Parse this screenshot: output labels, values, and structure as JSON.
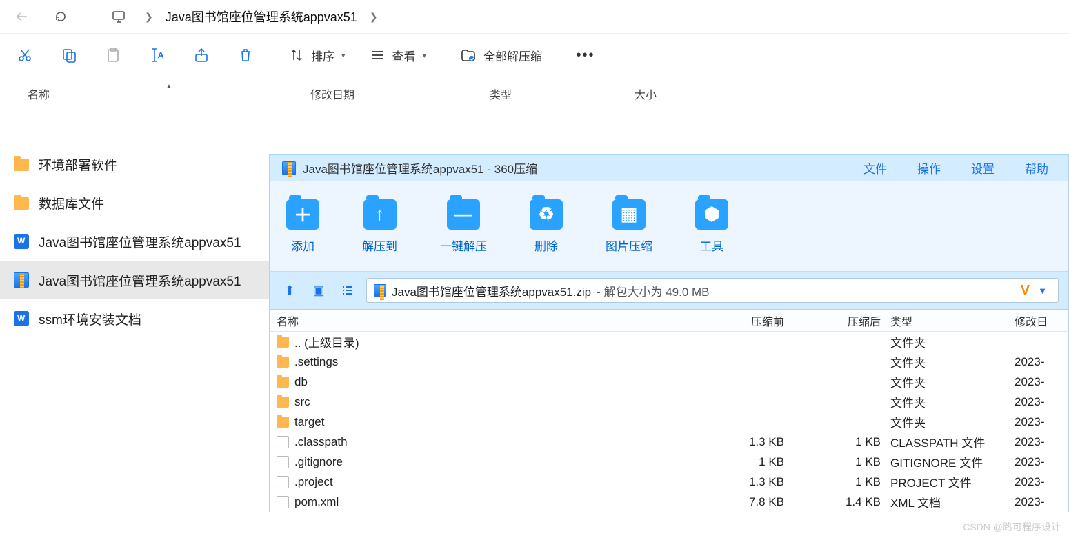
{
  "breadcrumb": {
    "title": "Java图书馆座位管理系统appvax51"
  },
  "toolbar": {
    "sort": "排序",
    "view": "查看",
    "extract_all": "全部解压缩"
  },
  "columns": {
    "name": "名称",
    "date": "修改日期",
    "type": "类型",
    "size": "大小"
  },
  "left_items": [
    {
      "icon": "folder",
      "label": "环境部署软件"
    },
    {
      "icon": "folder",
      "label": "数据库文件"
    },
    {
      "icon": "doc",
      "label": "Java图书馆座位管理系统appvax51"
    },
    {
      "icon": "zip",
      "label": "Java图书馆座位管理系统appvax51",
      "selected": true
    },
    {
      "icon": "doc",
      "label": "ssm环境安装文档"
    }
  ],
  "archive": {
    "title_prefix": "Java图书馆座位管理系统appvax51",
    "title_app": "360压缩",
    "menus": [
      "文件",
      "操作",
      "设置",
      "帮助"
    ],
    "tools": [
      {
        "label": "添加",
        "glyph": "＋"
      },
      {
        "label": "解压到",
        "glyph": "↑"
      },
      {
        "label": "一键解压",
        "glyph": "—"
      },
      {
        "label": "删除",
        "glyph": "♻"
      },
      {
        "label": "图片压缩",
        "glyph": "▦"
      },
      {
        "label": "工具",
        "glyph": "⬢"
      }
    ],
    "path_file": "Java图书馆座位管理系统appvax51.zip",
    "path_suffix": " - 解包大小为 49.0 MB",
    "cols": {
      "name": "名称",
      "pre": "压缩前",
      "post": "压缩后",
      "type": "类型",
      "date": "修改日"
    },
    "rows": [
      {
        "icon": "folder",
        "name": ".. (上级目录)",
        "pre": "",
        "post": "",
        "type": "文件夹",
        "date": ""
      },
      {
        "icon": "folder",
        "name": ".settings",
        "pre": "",
        "post": "",
        "type": "文件夹",
        "date": "2023-"
      },
      {
        "icon": "folder",
        "name": "db",
        "pre": "",
        "post": "",
        "type": "文件夹",
        "date": "2023-"
      },
      {
        "icon": "folder",
        "name": "src",
        "pre": "",
        "post": "",
        "type": "文件夹",
        "date": "2023-"
      },
      {
        "icon": "folder",
        "name": "target",
        "pre": "",
        "post": "",
        "type": "文件夹",
        "date": "2023-"
      },
      {
        "icon": "file",
        "name": ".classpath",
        "pre": "1.3 KB",
        "post": "1 KB",
        "type": "CLASSPATH 文件",
        "date": "2023-"
      },
      {
        "icon": "file",
        "name": ".gitignore",
        "pre": "1 KB",
        "post": "1 KB",
        "type": "GITIGNORE 文件",
        "date": "2023-"
      },
      {
        "icon": "file",
        "name": ".project",
        "pre": "1.3 KB",
        "post": "1 KB",
        "type": "PROJECT 文件",
        "date": "2023-"
      },
      {
        "icon": "file",
        "name": "pom.xml",
        "pre": "7.8 KB",
        "post": "1.4 KB",
        "type": "XML 文档",
        "date": "2023-"
      }
    ]
  },
  "watermark": "CSDN @路可程序设计"
}
